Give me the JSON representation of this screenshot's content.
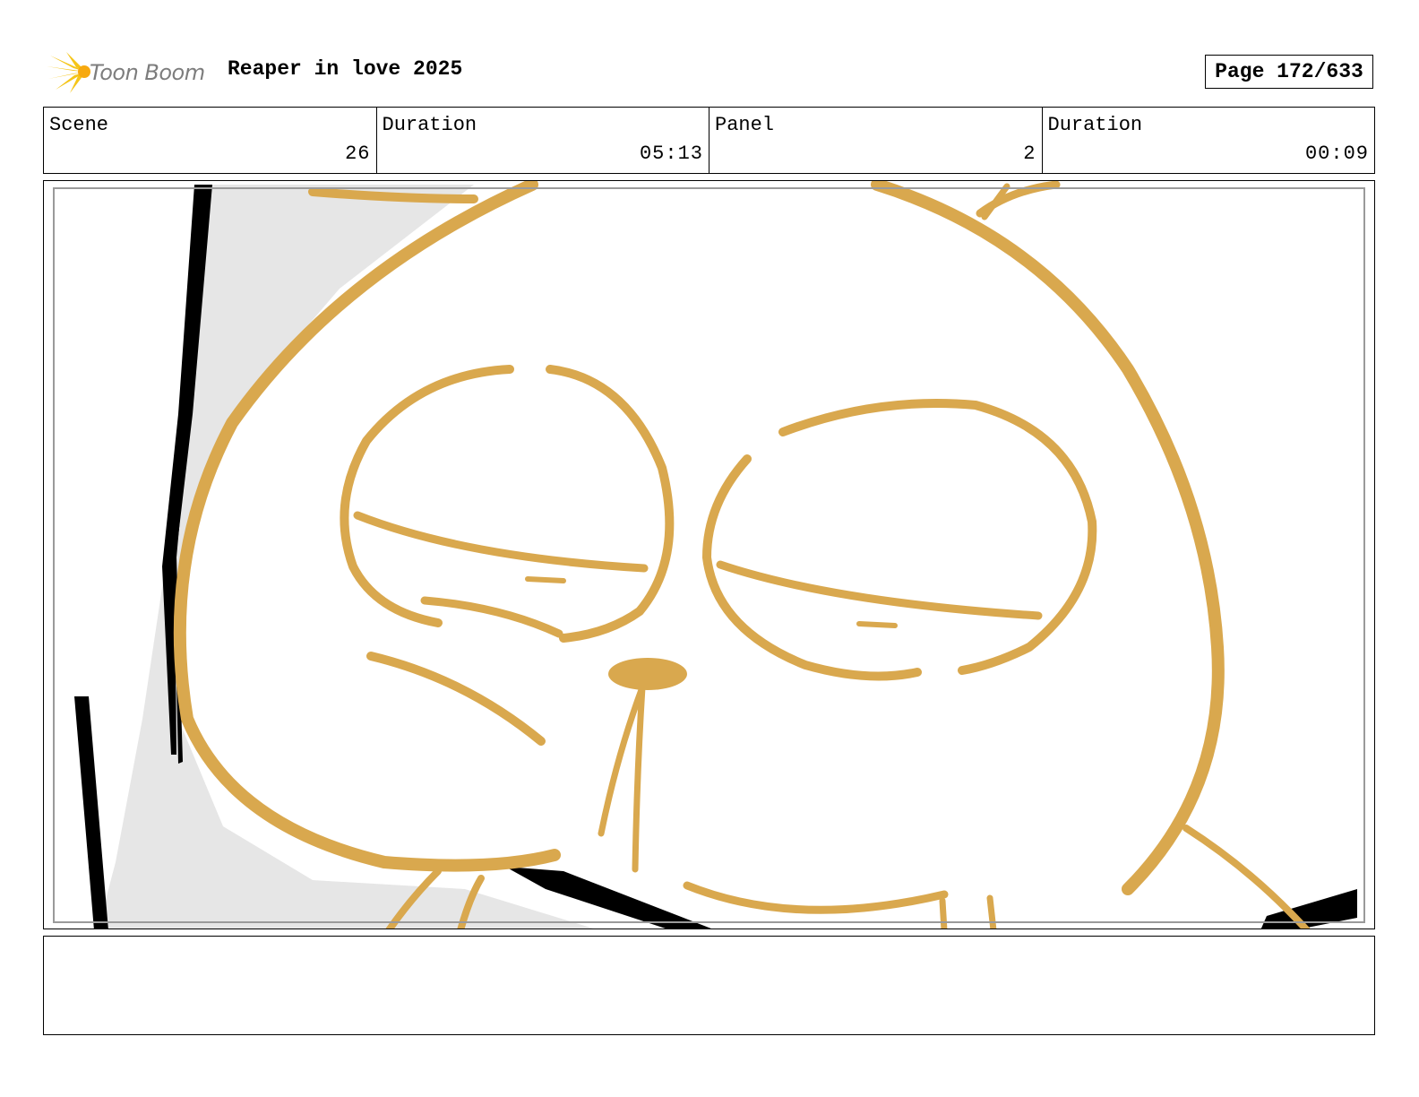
{
  "header": {
    "logo_text": "Toon Boom",
    "project_title": "Reaper in love 2025",
    "page_label": "Page 172/633"
  },
  "info": {
    "scene_label": "Scene",
    "scene_value": "26",
    "scene_duration_label": "Duration",
    "scene_duration_value": "05:13",
    "panel_label": "Panel",
    "panel_value": "2",
    "panel_duration_label": "Duration",
    "panel_duration_value": "00:09"
  },
  "colors": {
    "line_art": "#d9a84e",
    "background_fill": "#e6e6e6",
    "ink": "#000000",
    "logo_star": "#f5c518"
  },
  "notes": {
    "text": ""
  }
}
